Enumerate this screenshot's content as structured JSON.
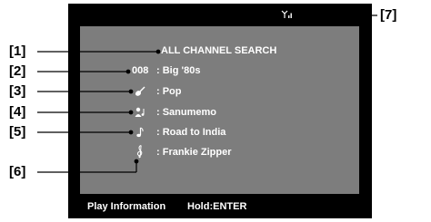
{
  "display": {
    "mode_title": "ALL CHANNEL SEARCH",
    "channel_number": "008",
    "channel_name": ": Big '80s",
    "category": ": Pop",
    "artist": ": Sanumemo",
    "song": ": Road to India",
    "composer": ": Frankie Zipper",
    "footer_left": "Play Information",
    "footer_right": "Hold:ENTER"
  },
  "callouts": {
    "c1": "[1]",
    "c2": "[2]",
    "c3": "[3]",
    "c4": "[4]",
    "c5": "[5]",
    "c6": "[6]",
    "c7": "[7]"
  },
  "icons": {
    "category": "guitar-icon",
    "artist": "artist-icon",
    "song": "music-note-icon",
    "composer": "treble-clef-icon",
    "signal": "antenna-signal-icon"
  },
  "colors": {
    "screen_bg": "#7d7d7d",
    "frame": "#000000",
    "text": "#ffffff"
  }
}
